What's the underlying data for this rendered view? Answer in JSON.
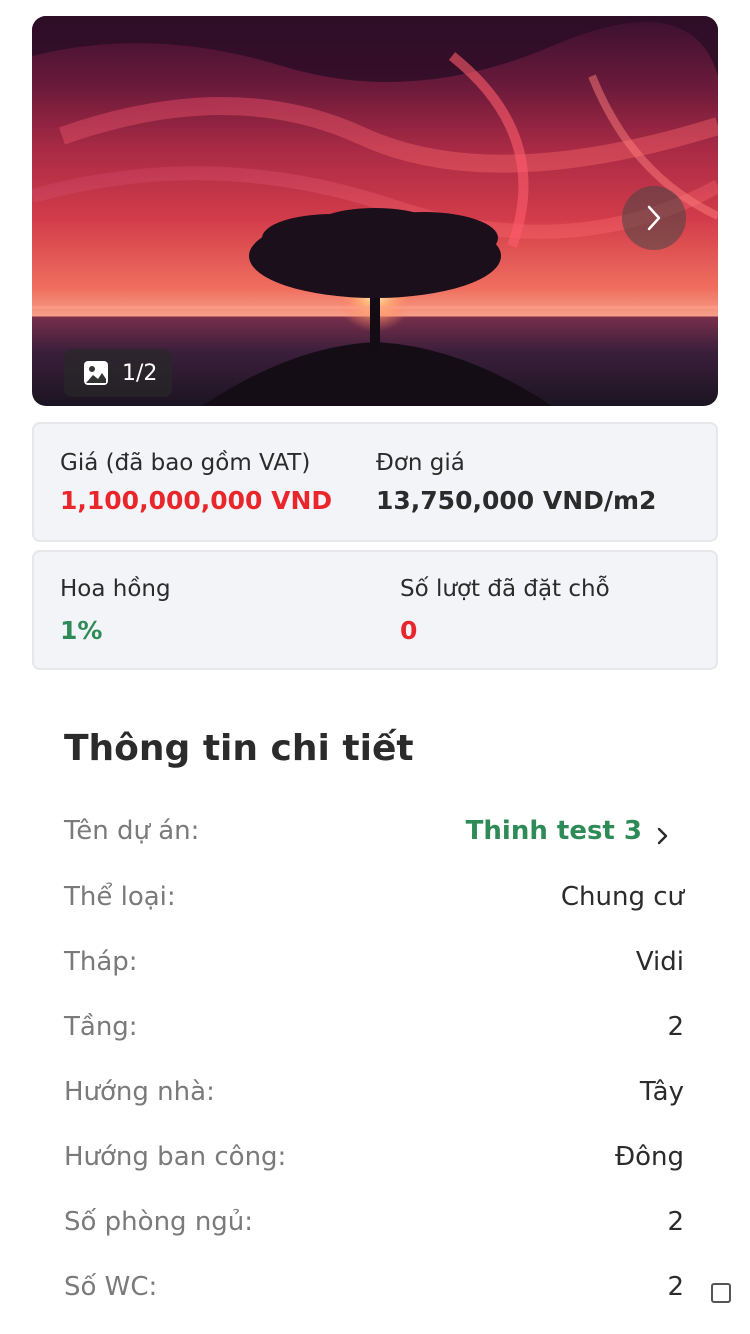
{
  "gallery": {
    "counter": "1/2"
  },
  "price_card": {
    "price_label": "Giá (đã bao gồm VAT)",
    "price_value": "1,100,000,000 VND",
    "unit_price_label": "Đơn giá",
    "unit_price_value": "13,750,000 VND/m2"
  },
  "stats_card": {
    "commission_label": "Hoa hồng",
    "commission_value": "1%",
    "bookings_label": "Số lượt đã đặt chỗ",
    "bookings_value": "0"
  },
  "details": {
    "title": "Thông tin chi tiết",
    "rows": [
      {
        "label": "Tên dự án:",
        "value": "Thinh test 3"
      },
      {
        "label": "Thể loại:",
        "value": "Chung cư"
      },
      {
        "label": "Tháp:",
        "value": "Vidi"
      },
      {
        "label": "Tầng:",
        "value": "2"
      },
      {
        "label": "Hướng nhà:",
        "value": "Tây"
      },
      {
        "label": "Hướng ban công:",
        "value": "Đông"
      },
      {
        "label": "Số phòng ngủ:",
        "value": "2"
      },
      {
        "label": "Số WC:",
        "value": "2"
      }
    ]
  },
  "colors": {
    "price_red": "#e8262b",
    "commission_green": "#2e8b57",
    "bookings_red": "#e8262b",
    "link_green": "#2e8b57"
  }
}
